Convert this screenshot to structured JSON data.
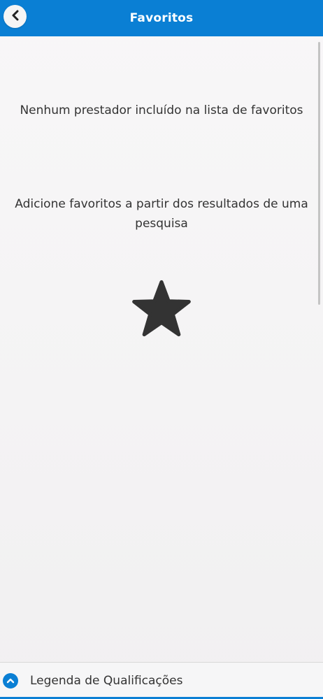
{
  "header": {
    "title": "Favoritos",
    "back_icon": "chevron-left-icon"
  },
  "content": {
    "empty_message": "Nenhum prestador incluído na lista de favoritos",
    "hint_message": "Adicione favoritos a partir dos resultados de uma pesquisa",
    "star_icon": "star-icon"
  },
  "footer": {
    "label": "Legenda de Qualificações",
    "icon": "chevron-up-icon"
  },
  "colors": {
    "brand_blue": "#0a7fd4",
    "text": "#333333",
    "star": "#333333"
  }
}
